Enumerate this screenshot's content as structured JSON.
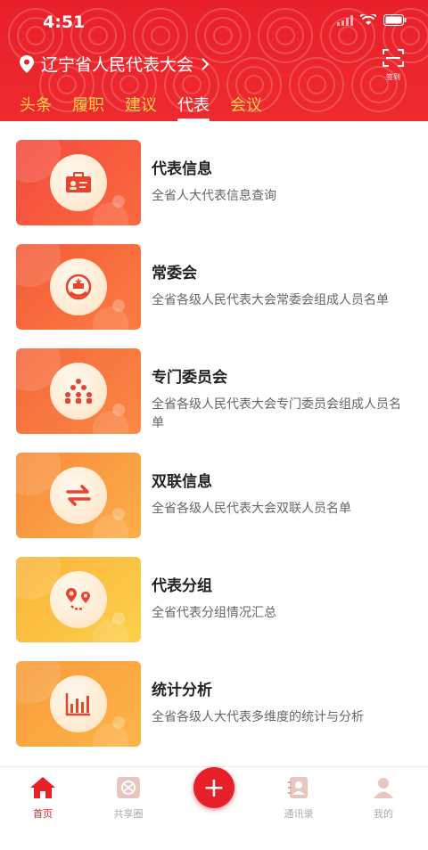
{
  "status": {
    "time": "4:51"
  },
  "header": {
    "location": "辽宁省人民代表大会",
    "scan_label": "签到",
    "tabs": [
      {
        "label": "头条",
        "active": false
      },
      {
        "label": "履职",
        "active": false
      },
      {
        "label": "建议",
        "active": false
      },
      {
        "label": "代表",
        "active": true
      },
      {
        "label": "会议",
        "active": false
      }
    ]
  },
  "items": [
    {
      "title": "代表信息",
      "desc": "全省人大代表信息查询",
      "icon": "id-card-icon"
    },
    {
      "title": "常委会",
      "desc": "全省各级人民代表大会常委会组成人员名单",
      "icon": "emblem-icon"
    },
    {
      "title": "专门委员会",
      "desc": "全省各级人民代表大会专门委员会组成人员名单",
      "icon": "group-icon"
    },
    {
      "title": "双联信息",
      "desc": "全省各级人民代表大会双联人员名单",
      "icon": "exchange-icon"
    },
    {
      "title": "代表分组",
      "desc": "全省代表分组情况汇总",
      "icon": "route-icon"
    },
    {
      "title": "统计分析",
      "desc": "全省各级人大代表多维度的统计与分析",
      "icon": "bar-chart-icon"
    }
  ],
  "tabbar": {
    "home": "首页",
    "share": "共享圈",
    "add": "+",
    "contacts": "通讯录",
    "mine": "我的"
  },
  "colors": {
    "accent": "#e8202a",
    "tab_inactive": "#ffd24a"
  }
}
